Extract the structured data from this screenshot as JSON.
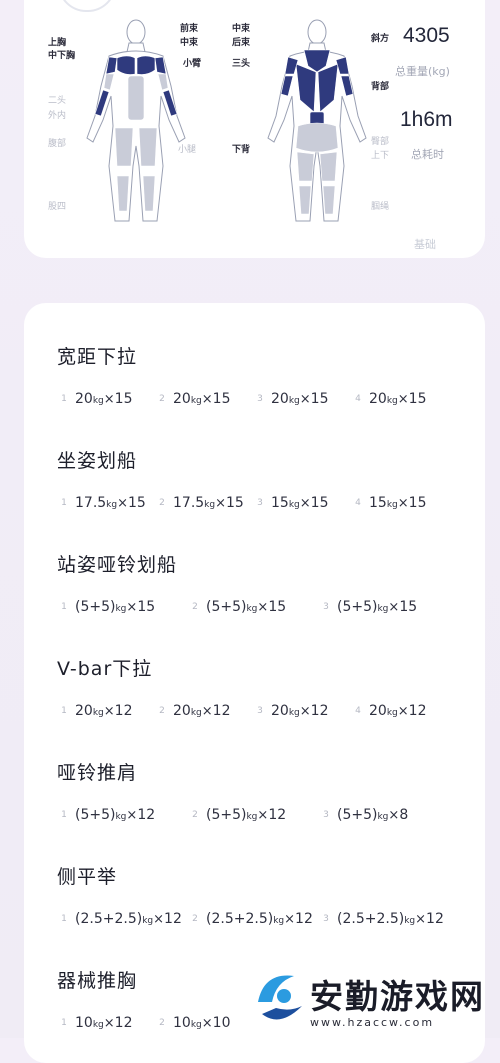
{
  "body_map": {
    "front_labels": [
      {
        "name": "label-upper-chest",
        "text": "上胸",
        "active": true
      },
      {
        "name": "label-mid-lower-chest",
        "text": "中下胸",
        "active": true
      },
      {
        "name": "label-front-delt",
        "text": "前束",
        "active": true
      },
      {
        "name": "label-mid-delt-front",
        "text": "中束",
        "active": true
      },
      {
        "name": "label-forearm",
        "text": "小臂",
        "active": true
      },
      {
        "name": "label-biceps",
        "text": "二头",
        "active": false
      },
      {
        "name": "label-adductor",
        "text": "外内",
        "active": false
      },
      {
        "name": "label-abs",
        "text": "腹部",
        "active": false
      },
      {
        "name": "label-calf",
        "text": "小腿",
        "active": false
      },
      {
        "name": "label-quads",
        "text": "股四",
        "active": false
      }
    ],
    "back_labels": [
      {
        "name": "label-mid-delt-back",
        "text": "中束",
        "active": true
      },
      {
        "name": "label-rear-delt",
        "text": "后束",
        "active": true
      },
      {
        "name": "label-triceps",
        "text": "三头",
        "active": true
      },
      {
        "name": "label-traps",
        "text": "斜方",
        "active": true
      },
      {
        "name": "label-back",
        "text": "背部",
        "active": true
      },
      {
        "name": "label-lower-back",
        "text": "下背",
        "active": true
      },
      {
        "name": "label-glutes",
        "text": "臀部",
        "active": false
      },
      {
        "name": "label-glutes-sub",
        "text": "上下",
        "active": false
      },
      {
        "name": "label-hamstrings",
        "text": "腘绳",
        "active": false
      }
    ]
  },
  "stats": {
    "total_weight_value": "4305",
    "total_weight_label": "总重量(kg)",
    "total_time_value": "1h6m",
    "total_time_label": "总耗时"
  },
  "level": "基础",
  "exercises": [
    {
      "name": "宽距下拉",
      "sets": [
        {
          "idx": "1",
          "w": "20",
          "u": "kg",
          "r": "15"
        },
        {
          "idx": "2",
          "w": "20",
          "u": "kg",
          "r": "15"
        },
        {
          "idx": "3",
          "w": "20",
          "u": "kg",
          "r": "15"
        },
        {
          "idx": "4",
          "w": "20",
          "u": "kg",
          "r": "15"
        }
      ]
    },
    {
      "name": "坐姿划船",
      "sets": [
        {
          "idx": "1",
          "w": "17.5",
          "u": "kg",
          "r": "15"
        },
        {
          "idx": "2",
          "w": "17.5",
          "u": "kg",
          "r": "15"
        },
        {
          "idx": "3",
          "w": "15",
          "u": "kg",
          "r": "15"
        },
        {
          "idx": "4",
          "w": "15",
          "u": "kg",
          "r": "15"
        }
      ]
    },
    {
      "name": "站姿哑铃划船",
      "sets": [
        {
          "idx": "1",
          "w": "(5+5)",
          "u": "kg",
          "r": "15"
        },
        {
          "idx": "2",
          "w": "(5+5)",
          "u": "kg",
          "r": "15"
        },
        {
          "idx": "3",
          "w": "(5+5)",
          "u": "kg",
          "r": "15"
        }
      ]
    },
    {
      "name": "V-bar下拉",
      "sets": [
        {
          "idx": "1",
          "w": "20",
          "u": "kg",
          "r": "12"
        },
        {
          "idx": "2",
          "w": "20",
          "u": "kg",
          "r": "12"
        },
        {
          "idx": "3",
          "w": "20",
          "u": "kg",
          "r": "12"
        },
        {
          "idx": "4",
          "w": "20",
          "u": "kg",
          "r": "12"
        }
      ]
    },
    {
      "name": "哑铃推肩",
      "sets": [
        {
          "idx": "1",
          "w": "(5+5)",
          "u": "kg",
          "r": "12"
        },
        {
          "idx": "2",
          "w": "(5+5)",
          "u": "kg",
          "r": "12"
        },
        {
          "idx": "3",
          "w": "(5+5)",
          "u": "kg",
          "r": "8"
        }
      ]
    },
    {
      "name": "侧平举",
      "sets": [
        {
          "idx": "1",
          "w": "(2.5+2.5)",
          "u": "kg",
          "r": "12"
        },
        {
          "idx": "2",
          "w": "(2.5+2.5)",
          "u": "kg",
          "r": "12"
        },
        {
          "idx": "3",
          "w": "(2.5+2.5)",
          "u": "kg",
          "r": "12"
        }
      ]
    },
    {
      "name": "器械推胸",
      "sets": [
        {
          "idx": "1",
          "w": "10",
          "u": "kg",
          "r": "12"
        },
        {
          "idx": "2",
          "w": "10",
          "u": "kg",
          "r": "10"
        }
      ]
    }
  ],
  "times_symbol": "×",
  "watermark": {
    "title": "安勤游戏网",
    "url": "www.hzaccw.com"
  },
  "colors": {
    "muscle_active": "#2f3a7e",
    "muscle_inactive": "#c9ccd8",
    "skin": "#ffffff"
  }
}
